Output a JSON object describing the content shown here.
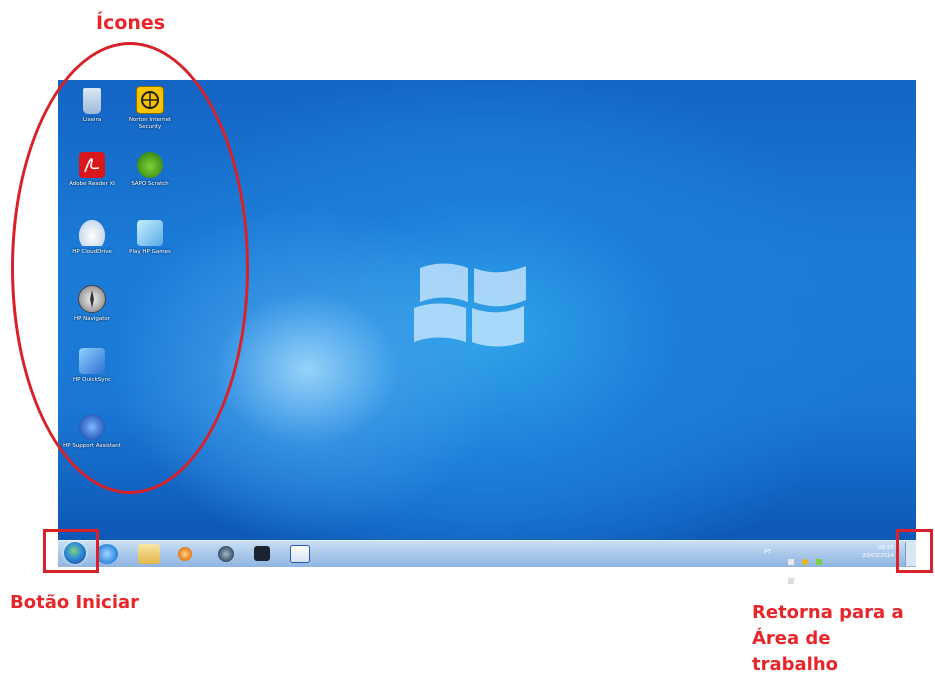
{
  "annotations": {
    "icons_label": "Ícones",
    "start_label": "Botão Iniciar",
    "desktop_label_lines": [
      "Retorna para a",
      "Área de",
      "trabalho"
    ]
  },
  "desktop": {
    "icons": [
      {
        "label": "Lixeira",
        "icon": "recycle-bin-icon",
        "color": "#b9d3ea"
      },
      {
        "label": "Norton Internet Security",
        "icon": "norton-icon",
        "color": "#f5c400"
      },
      {
        "label": "Adobe Reader XI",
        "icon": "adobe-reader-icon",
        "color": "#d9161c"
      },
      {
        "label": "SAPO Scratch",
        "icon": "sapo-scratch-icon",
        "color": "#6bbf2a"
      },
      {
        "label": "HP CloudDrive",
        "icon": "cloud-drive-icon",
        "color": "#e7eef6"
      },
      {
        "label": "Play HP Games",
        "icon": "hp-games-icon",
        "color": "#8fd0ff"
      },
      {
        "label": "HP Navigator",
        "icon": "compass-icon",
        "color": "#c8c8c8"
      },
      {
        "label": "HP QuickSync",
        "icon": "quicksync-icon",
        "color": "#3f89e6"
      },
      {
        "label": "HP Support Assistant",
        "icon": "support-assistant-icon",
        "color": "#2d6fd0"
      }
    ]
  },
  "taskbar": {
    "pinned": [
      {
        "name": "internet-explorer-icon",
        "color": "#3b9be8"
      },
      {
        "name": "explorer-folder-icon",
        "color": "#f1cf63"
      },
      {
        "name": "media-player-icon",
        "color": "#f08a1e"
      },
      {
        "name": "browser-globe-icon",
        "color": "#4a5f76"
      },
      {
        "name": "camera-icon",
        "color": "#1b2230"
      },
      {
        "name": "word-icon",
        "color": "#2a5ab8"
      }
    ],
    "tray_lang": "PT",
    "clock_time": "08:55",
    "clock_date": "23/03/2014"
  }
}
